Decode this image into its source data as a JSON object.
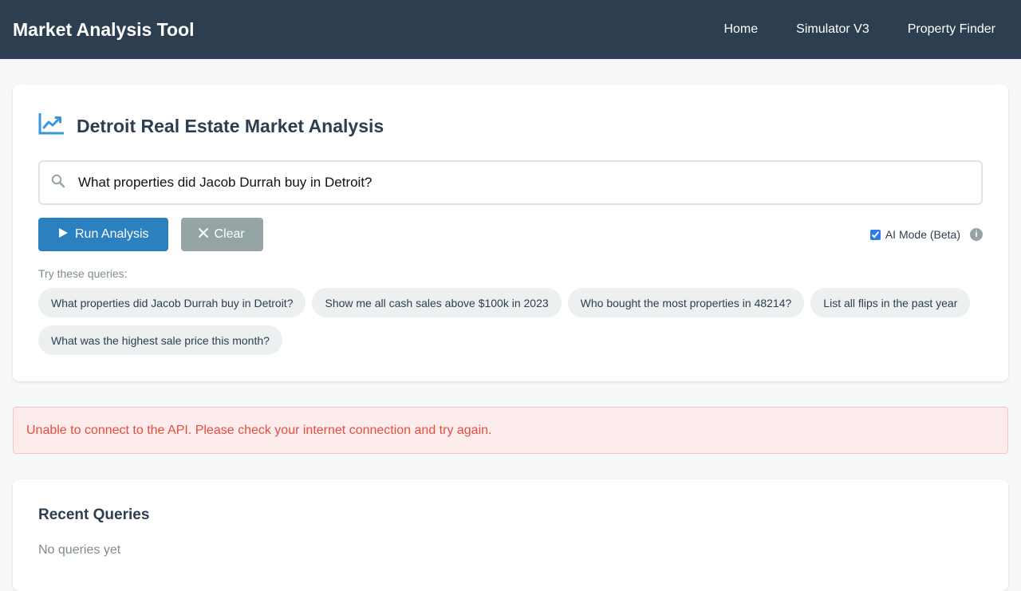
{
  "header": {
    "title": "Market Analysis Tool",
    "nav": [
      "Home",
      "Simulator V3",
      "Property Finder"
    ]
  },
  "analysis": {
    "title": "Detroit Real Estate Market Analysis",
    "search": {
      "value": "What properties did Jacob Durrah buy in Detroit?",
      "icon": "search-icon"
    },
    "run_label": "Run Analysis",
    "clear_label": "Clear",
    "ai_mode": {
      "label": "AI Mode (Beta)",
      "checked": true
    },
    "try_label": "Try these queries:",
    "suggestions": [
      "What properties did Jacob Durrah buy in Detroit?",
      "Show me all cash sales above $100k in 2023",
      "Who bought the most properties in 48214?",
      "List all flips in the past year",
      "What was the highest sale price this month?"
    ]
  },
  "error": {
    "message": "Unable to connect to the API. Please check your internet connection and try again."
  },
  "recent": {
    "title": "Recent Queries",
    "empty": "No queries yet"
  },
  "colors": {
    "header": "#2c3e50",
    "primary": "#2b80bf",
    "secondary": "#95a5a6",
    "error": "#e74c3c"
  }
}
